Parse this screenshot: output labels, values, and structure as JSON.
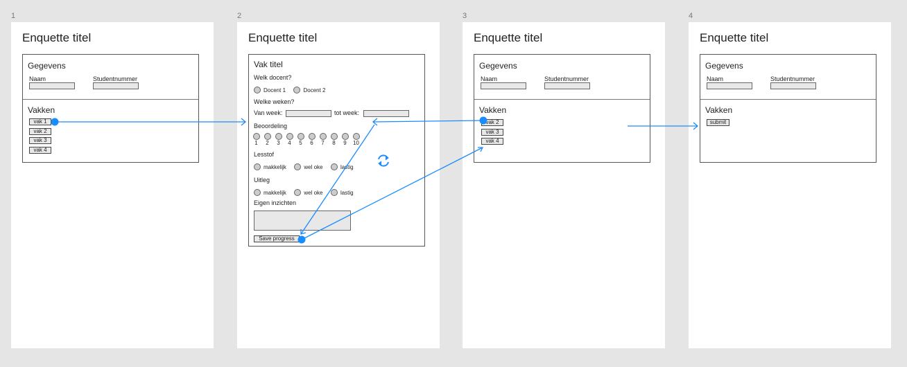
{
  "frames": [
    {
      "number": "1",
      "title": "Enquette titel",
      "gegevens": "Gegevens",
      "naam": "Naam",
      "studentnummer": "Studentnummer",
      "vakken": "Vakken",
      "vak_buttons": [
        "vak 1",
        "vak 2",
        "vak 3",
        "vak 4"
      ]
    },
    {
      "number": "2",
      "title": "Enquette titel",
      "vak_titel": "Vak titel",
      "q_docent": "Welk docent?",
      "docenten": [
        "Docent 1",
        "Docent 2"
      ],
      "q_weken": "Welke weken?",
      "van_week": "Van week:",
      "tot_week": "tot week:",
      "beoordeling": "Beoordeling",
      "scale": [
        "1",
        "2",
        "3",
        "4",
        "5",
        "6",
        "7",
        "8",
        "9",
        "10"
      ],
      "lesstof": "Lesstof",
      "lesstof_options": [
        "makkelijk",
        "wel oke",
        "lastig"
      ],
      "uitleg": "Uitleg",
      "uitleg_options": [
        "makkelijk",
        "wel oke",
        "lastig"
      ],
      "eigen": "Eigen inzichten",
      "save": "Save progress"
    },
    {
      "number": "3",
      "title": "Enquette titel",
      "gegevens": "Gegevens",
      "naam": "Naam",
      "studentnummer": "Studentnummer",
      "vakken": "Vakken",
      "vak_buttons": [
        "vak 2",
        "vak 3",
        "vak 4"
      ]
    },
    {
      "number": "4",
      "title": "Enquette titel",
      "gegevens": "Gegevens",
      "naam": "Naam",
      "studentnummer": "Studentnummer",
      "vakken": "Vakken",
      "submit": "submit"
    }
  ],
  "colors": {
    "canvas": "#e5e5e5",
    "connector": "#1a8cff"
  }
}
